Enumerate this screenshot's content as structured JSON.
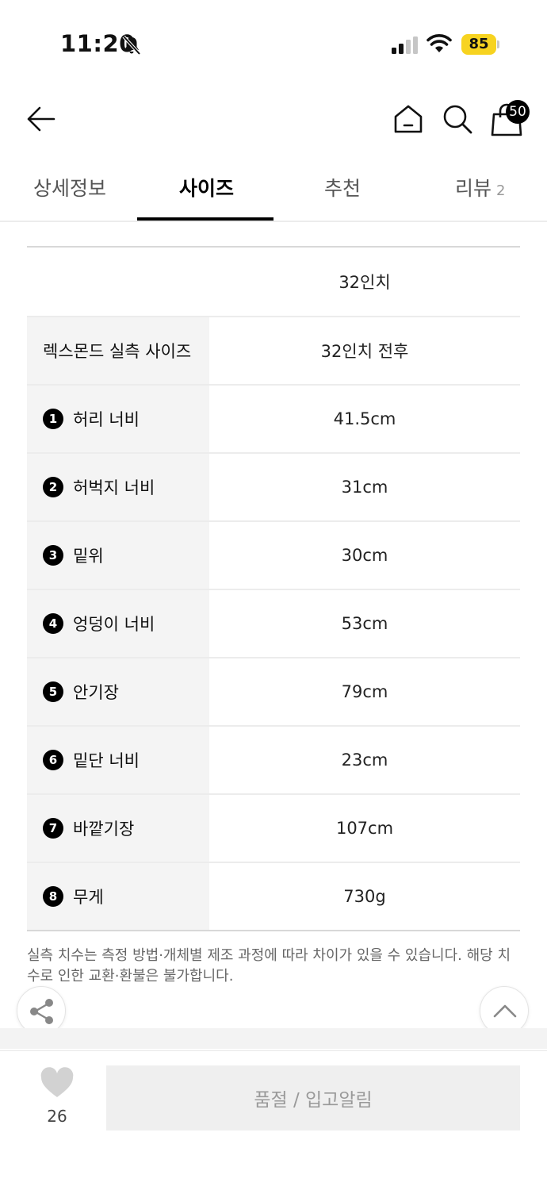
{
  "status_bar": {
    "time": "11:20",
    "battery": "85"
  },
  "header": {
    "cart_count": "50"
  },
  "tabs": [
    {
      "label": "상세정보"
    },
    {
      "label": "사이즈"
    },
    {
      "label": "추천"
    },
    {
      "label": "리뷰",
      "count": "2"
    }
  ],
  "size_table": {
    "column_header": "32인치",
    "rows": [
      {
        "num": "",
        "label": "렉스몬드 실측 사이즈",
        "value": "32인치 전후"
      },
      {
        "num": "1",
        "label": "허리 너비",
        "value": "41.5cm"
      },
      {
        "num": "2",
        "label": "허벅지 너비",
        "value": "31cm"
      },
      {
        "num": "3",
        "label": "밑위",
        "value": "30cm"
      },
      {
        "num": "4",
        "label": "엉덩이 너비",
        "value": "53cm"
      },
      {
        "num": "5",
        "label": "안기장",
        "value": "79cm"
      },
      {
        "num": "6",
        "label": "밑단 너비",
        "value": "23cm"
      },
      {
        "num": "7",
        "label": "바깥기장",
        "value": "107cm"
      },
      {
        "num": "8",
        "label": "무게",
        "value": "730g"
      }
    ]
  },
  "note": "실측 치수는 측정 방법·개체별 제조 과정에 따라 차이가 있을 수 있습니다. 해당 치수로 인한 교환·환불은 불가합니다.",
  "bottom_bar": {
    "like_count": "26",
    "action_label": "품절 / 입고알림"
  },
  "colors": {
    "battery": "#f7d320",
    "row_label_bg": "#f4f4f4",
    "disabled_button": "#efefef"
  }
}
